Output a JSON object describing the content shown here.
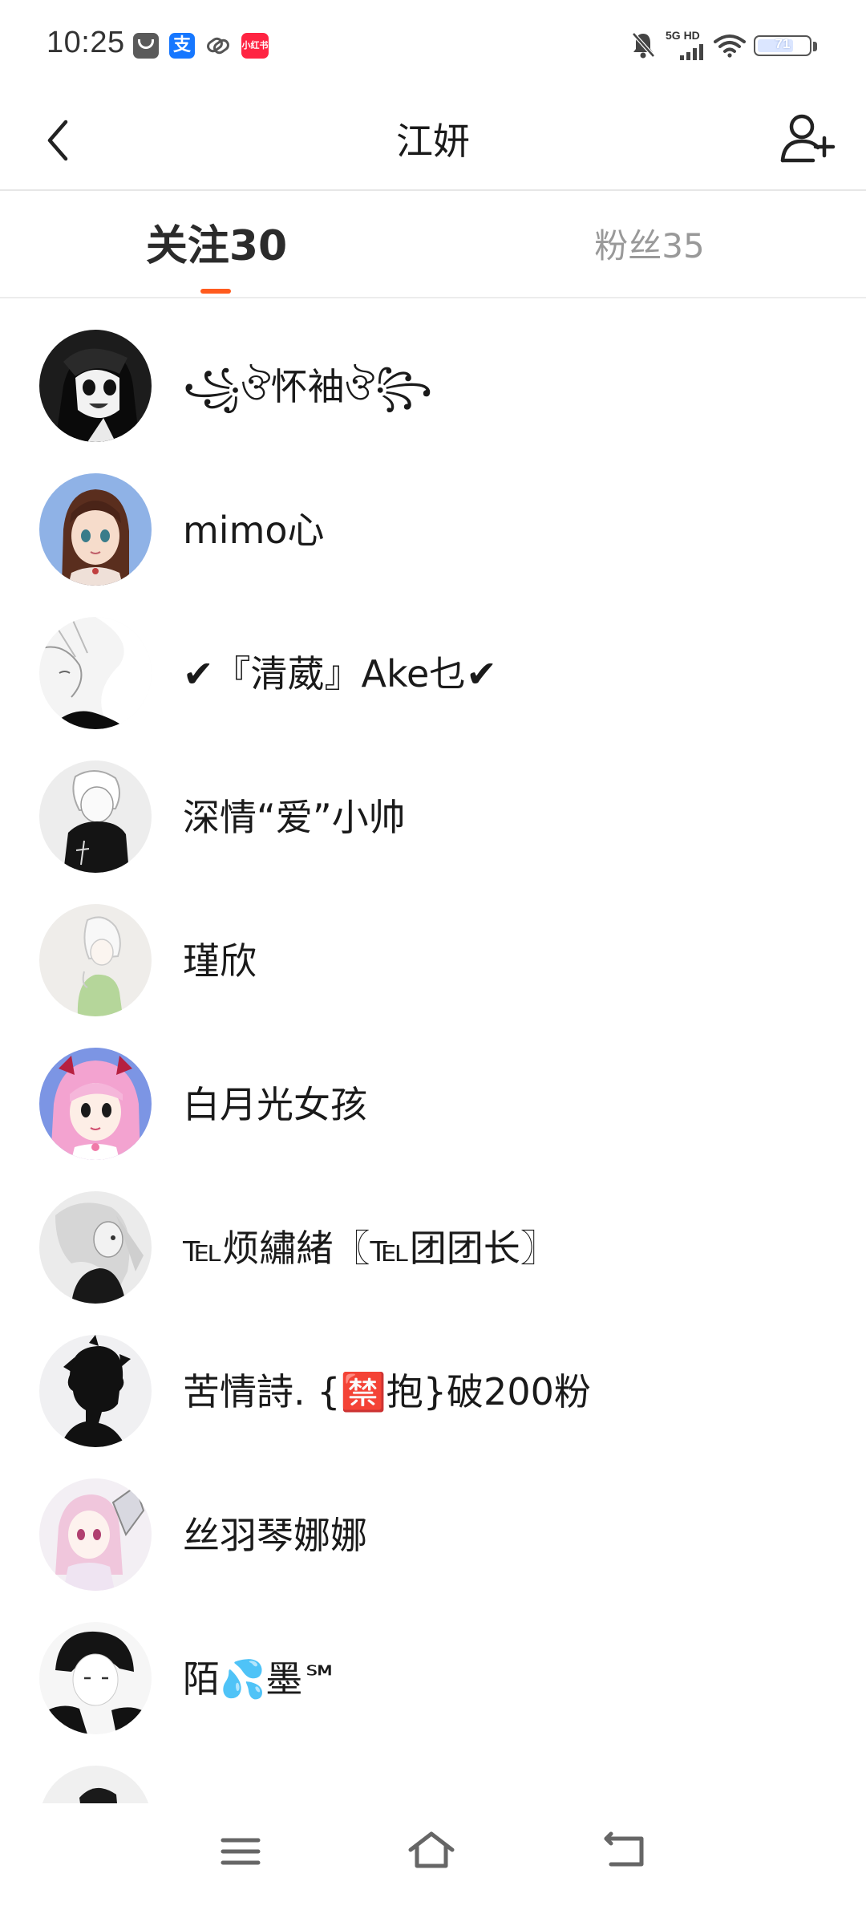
{
  "status_bar": {
    "time": "10:25",
    "notifications": [
      "mail-icon",
      "alipay-icon",
      "link-icon",
      "xiaohongshu-icon"
    ],
    "alipay_glyph": "支",
    "xhs_label": "小红书",
    "network": "5G HD",
    "battery": "71",
    "battery_level": 71
  },
  "header": {
    "title": "江妍",
    "back_icon": "chevron-left-icon",
    "action_icon": "add-user-icon"
  },
  "tabs": [
    {
      "label": "关注30",
      "active": true
    },
    {
      "label": "粉丝35",
      "active": false
    }
  ],
  "colors": {
    "accent": "#ff5b1e",
    "text_primary": "#1a1a1a",
    "text_secondary": "#999999",
    "divider": "#e6e6e6"
  },
  "users": [
    {
      "name": "꧁ঔ怀袖ঔ꧂"
    },
    {
      "name": "mimo心"
    },
    {
      "name": "✔『清葳』Ake乜✔"
    },
    {
      "name": "深情“爱”小帅"
    },
    {
      "name": "瑾欣"
    },
    {
      "name": "白月光女孩"
    },
    {
      "name": "℡烦繡緒〖℡团团长〗"
    },
    {
      "name": "苦情詩. {🈲抱}破200粉"
    },
    {
      "name": "丝羽琴娜娜"
    },
    {
      "name": "陌💦墨℠"
    },
    {
      "name": ""
    }
  ],
  "nav_bar": {
    "items": [
      "menu-icon",
      "home-icon",
      "back-icon"
    ]
  }
}
